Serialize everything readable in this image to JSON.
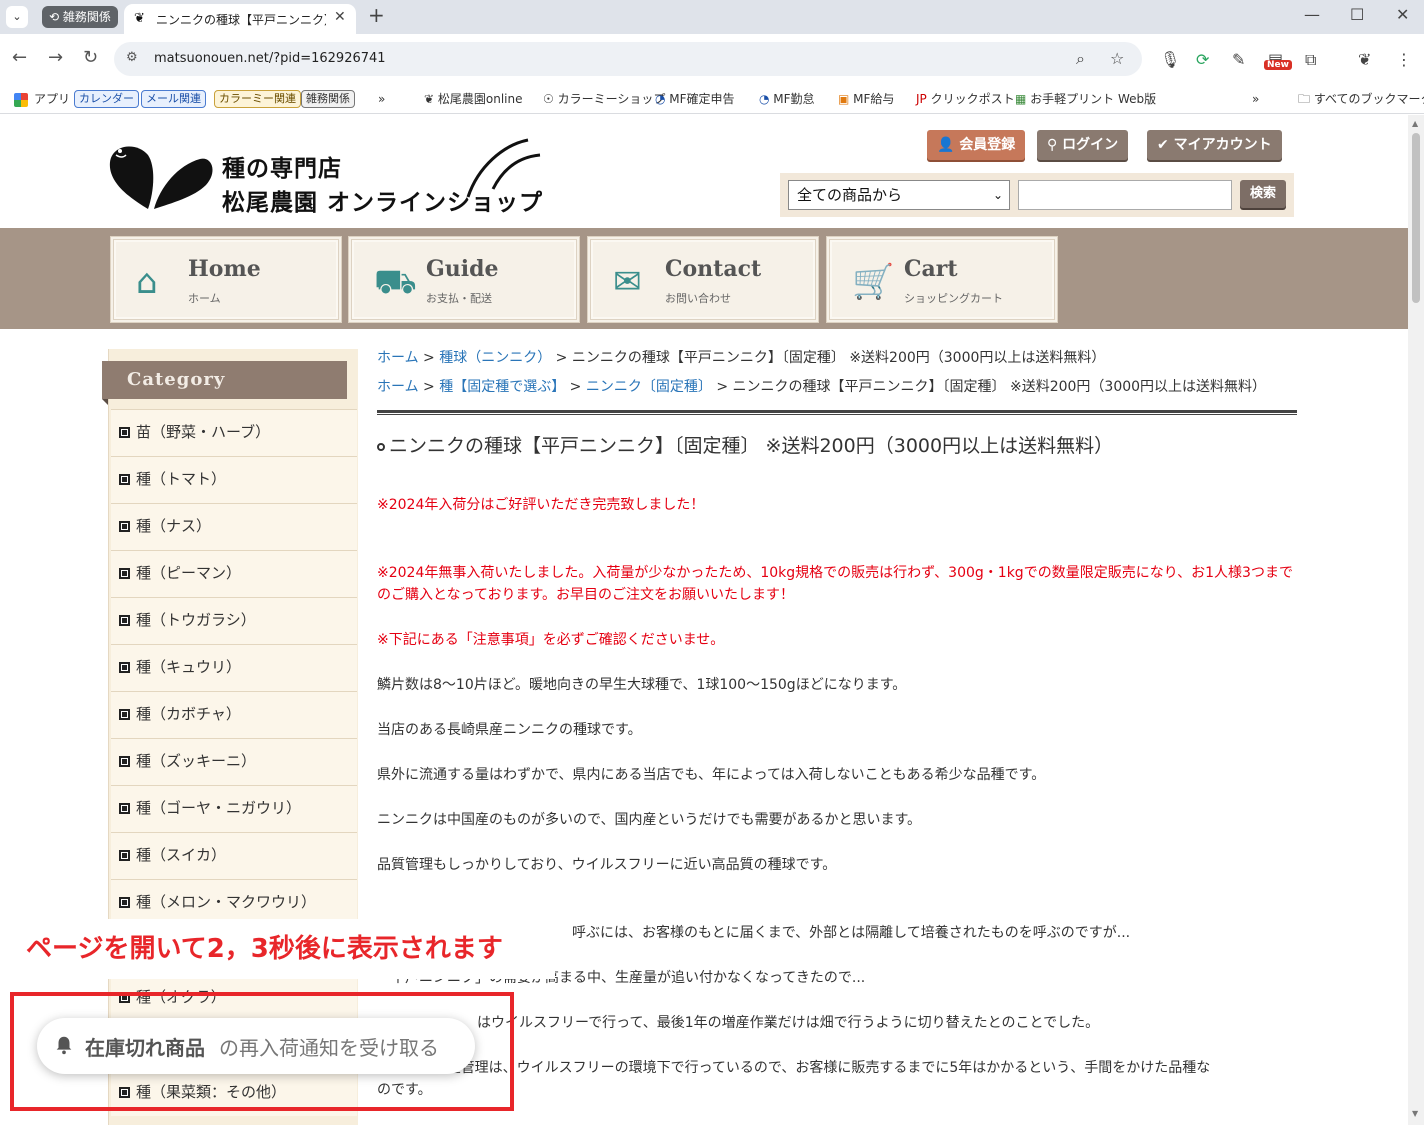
{
  "browser": {
    "tab_group_label": "雑務関係",
    "active_tab_title": "ニンニクの種球【平戸ニンニク】〔固定",
    "url": "matsuonouen.net/?pid=162926741",
    "new_badge": "New",
    "bookmarks": {
      "apps": "アプリ",
      "chip_calendar": "カレンダー",
      "chip_mail": "メール関連",
      "chip_colorme": "カラーミー関連",
      "chip_misc": "雑務関係",
      "overflow": "»",
      "items": [
        "松尾農園online",
        "カラーミーショップ",
        "MF確定申告",
        "MF勤怠",
        "MF給与",
        "クリックポスト",
        "お手軽プリント Web版"
      ],
      "all": "すべてのブックマーク"
    }
  },
  "site": {
    "logo_line1": "種の専門店",
    "logo_line2": "松尾農園 オンラインショップ",
    "account_buttons": {
      "register": "会員登録",
      "login": "ログイン",
      "my_account": "マイアカウント"
    },
    "search": {
      "select_value": "全ての商品から",
      "input_value": "",
      "button": "検索"
    },
    "nav": [
      {
        "en": "Home",
        "ja": "ホーム"
      },
      {
        "en": "Guide",
        "ja": "お支払・配送"
      },
      {
        "en": "Contact",
        "ja": "お問い合わせ"
      },
      {
        "en": "Cart",
        "ja": "ショッピングカート"
      }
    ]
  },
  "sidebar": {
    "heading": "Category",
    "items": [
      "苗（野菜・ハーブ）",
      "種（トマト）",
      "種（ナス）",
      "種（ピーマン）",
      "種（トウガラシ）",
      "種（キュウリ）",
      "種（カボチャ）",
      "種（ズッキーニ）",
      "種（ゴーヤ・ニガウリ）",
      "種（スイカ）",
      "種（メロン・マクワウリ）",
      "種（オクラ）",
      "種（果菜類：その他）"
    ]
  },
  "breadcrumbs": {
    "row1": {
      "home": "ホーム",
      "cat": "種球（ニンニク）",
      "current": "ニンニクの種球【平戸ニンニク】〔固定種〕 ※送料200円（3000円以上は送料無料）"
    },
    "row2": {
      "home": "ホーム",
      "cat1": "種【固定種で選ぶ】",
      "cat2": "ニンニク〔固定種〕",
      "current": "ニンニクの種球【平戸ニンニク】〔固定種〕 ※送料200円（3000円以上は送料無料）"
    }
  },
  "product": {
    "title": "ニンニクの種球【平戸ニンニク】〔固定種〕 ※送料200円（3000円以上は送料無料）",
    "notice1": "※2024年入荷分はご好評いただき完売致しました！",
    "notice2": "※2024年無事入荷いたしました。入荷量が少なかったため、10kg規格での販売は行わず、300g・1kgでの数量限定販売になり、お1人様3つまでのご購入となっております。お早目のご注文をお願いいたします！",
    "notice3": "※下記にある「注意事項」を必ずご確認くださいませ。",
    "p1": "鱗片数は8～10片ほど。暖地向きの早生大球種で、1球100～150gほどになります。",
    "p2": "当店のある長崎県産ニンニクの種球です。",
    "p3": "県外に流通する量はわずかで、県内にある当店でも、年によっては入荷しないこともある希少な品種です。",
    "p4": "ニンニクは中国産のものが多いので、国内産というだけでも需要があるかと思います。",
    "p5": "品質管理もしっかりしており、ウイルスフリーに近い高品質の種球です。",
    "p6_partial": "呼ぶには、お客様のもとに届くまで、外部とは隔離して培養されたものを呼ぶのですが...",
    "p7_partial": "「平戸ニンニク」の需要が高まる中、生産量が追い付かなくなってきたので...",
    "p8_partial": "はウイルスフリーで行って、最後1年の増産作業だけは畑で行うように切り替えたとのことでした。",
    "p9_partial": "それでも原種管理は、ウイルスフリーの環境下で行っているので、お客様に販売するまでに5年はかかるという、手間をかけた品種な",
    "p9_cont": "のです。"
  },
  "overlay": {
    "annotation": "ページを開いて2，3秒後に表示されます",
    "restock_strong": "在庫切れ商品",
    "restock_rest": "の再入荷通知を受け取る"
  },
  "colors": {
    "accent_red": "#e8262a",
    "link": "#2a75b8",
    "nav_band": "#a69587"
  }
}
